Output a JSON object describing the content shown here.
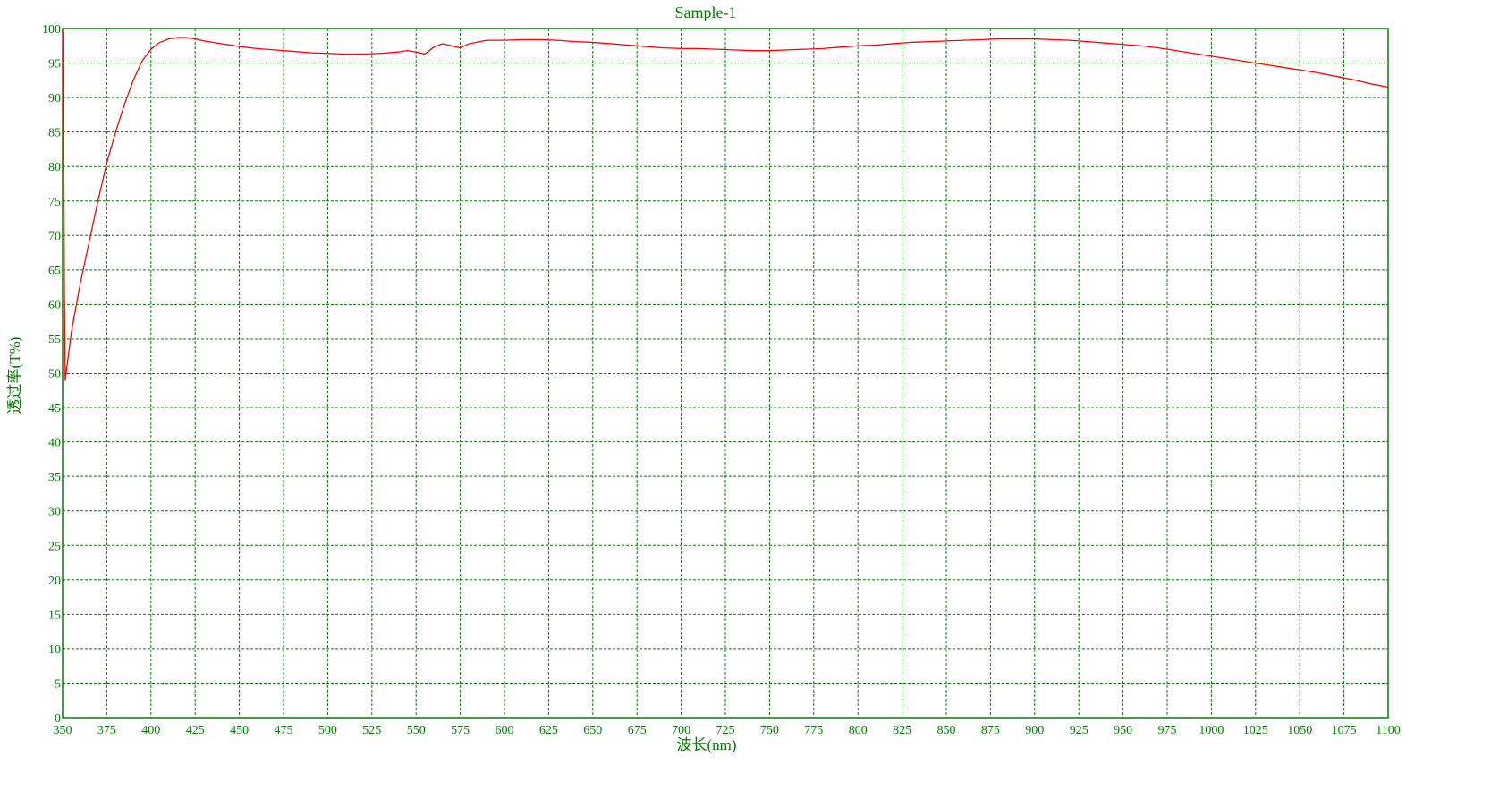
{
  "chart_data": {
    "type": "line",
    "title": "Sample-1",
    "xlabel": "波长(nm)",
    "ylabel": "透过率(T%)",
    "xlim": [
      350,
      1100
    ],
    "ylim": [
      0,
      100
    ],
    "x_ticks": [
      350,
      375,
      400,
      425,
      450,
      475,
      500,
      525,
      550,
      575,
      600,
      625,
      650,
      675,
      700,
      725,
      750,
      775,
      800,
      825,
      850,
      875,
      900,
      925,
      950,
      975,
      1000,
      1025,
      1050,
      1075,
      1100
    ],
    "y_ticks": [
      0,
      5,
      10,
      15,
      20,
      25,
      30,
      35,
      40,
      45,
      50,
      55,
      60,
      65,
      70,
      75,
      80,
      85,
      90,
      95,
      100
    ],
    "grid": true,
    "colors": {
      "axis": "#008000",
      "grid": "#008000",
      "series": "#ff0000"
    },
    "series": [
      {
        "x": [
          350,
          350.5,
          351,
          351.5,
          352,
          355,
          360,
          365,
          370,
          375,
          380,
          385,
          390,
          395,
          400,
          405,
          410,
          415,
          420,
          425,
          430,
          440,
          450,
          460,
          470,
          480,
          490,
          500,
          510,
          520,
          530,
          540,
          545,
          550,
          555,
          560,
          565,
          570,
          575,
          580,
          590,
          600,
          610,
          620,
          630,
          640,
          650,
          660,
          670,
          680,
          690,
          700,
          710,
          720,
          730,
          740,
          750,
          760,
          770,
          780,
          790,
          800,
          810,
          820,
          830,
          840,
          850,
          860,
          870,
          880,
          890,
          900,
          910,
          920,
          930,
          940,
          950,
          960,
          970,
          980,
          990,
          1000,
          1010,
          1020,
          1030,
          1040,
          1050,
          1060,
          1070,
          1080,
          1090,
          1100
        ],
        "y": [
          100,
          90,
          62,
          49,
          50,
          56,
          63,
          69,
          75,
          80.5,
          85,
          89,
          92.5,
          95.3,
          97,
          98,
          98.5,
          98.7,
          98.7,
          98.5,
          98.2,
          97.8,
          97.4,
          97.1,
          96.9,
          96.7,
          96.5,
          96.4,
          96.3,
          96.3,
          96.4,
          96.6,
          96.8,
          96.6,
          96.3,
          97.3,
          97.8,
          97.5,
          97.2,
          97.8,
          98.3,
          98.3,
          98.4,
          98.4,
          98.3,
          98.1,
          98.0,
          97.8,
          97.6,
          97.4,
          97.2,
          97.1,
          97.1,
          97.0,
          96.9,
          96.8,
          96.8,
          96.9,
          97.0,
          97.1,
          97.3,
          97.5,
          97.6,
          97.8,
          98.0,
          98.1,
          98.2,
          98.3,
          98.4,
          98.5,
          98.5,
          98.5,
          98.4,
          98.3,
          98.1,
          97.9,
          97.7,
          97.5,
          97.2,
          96.8,
          96.4,
          96.0,
          95.6,
          95.2,
          94.8,
          94.4,
          94.0,
          93.6,
          93.1,
          92.6,
          92.0,
          91.5
        ]
      }
    ]
  }
}
